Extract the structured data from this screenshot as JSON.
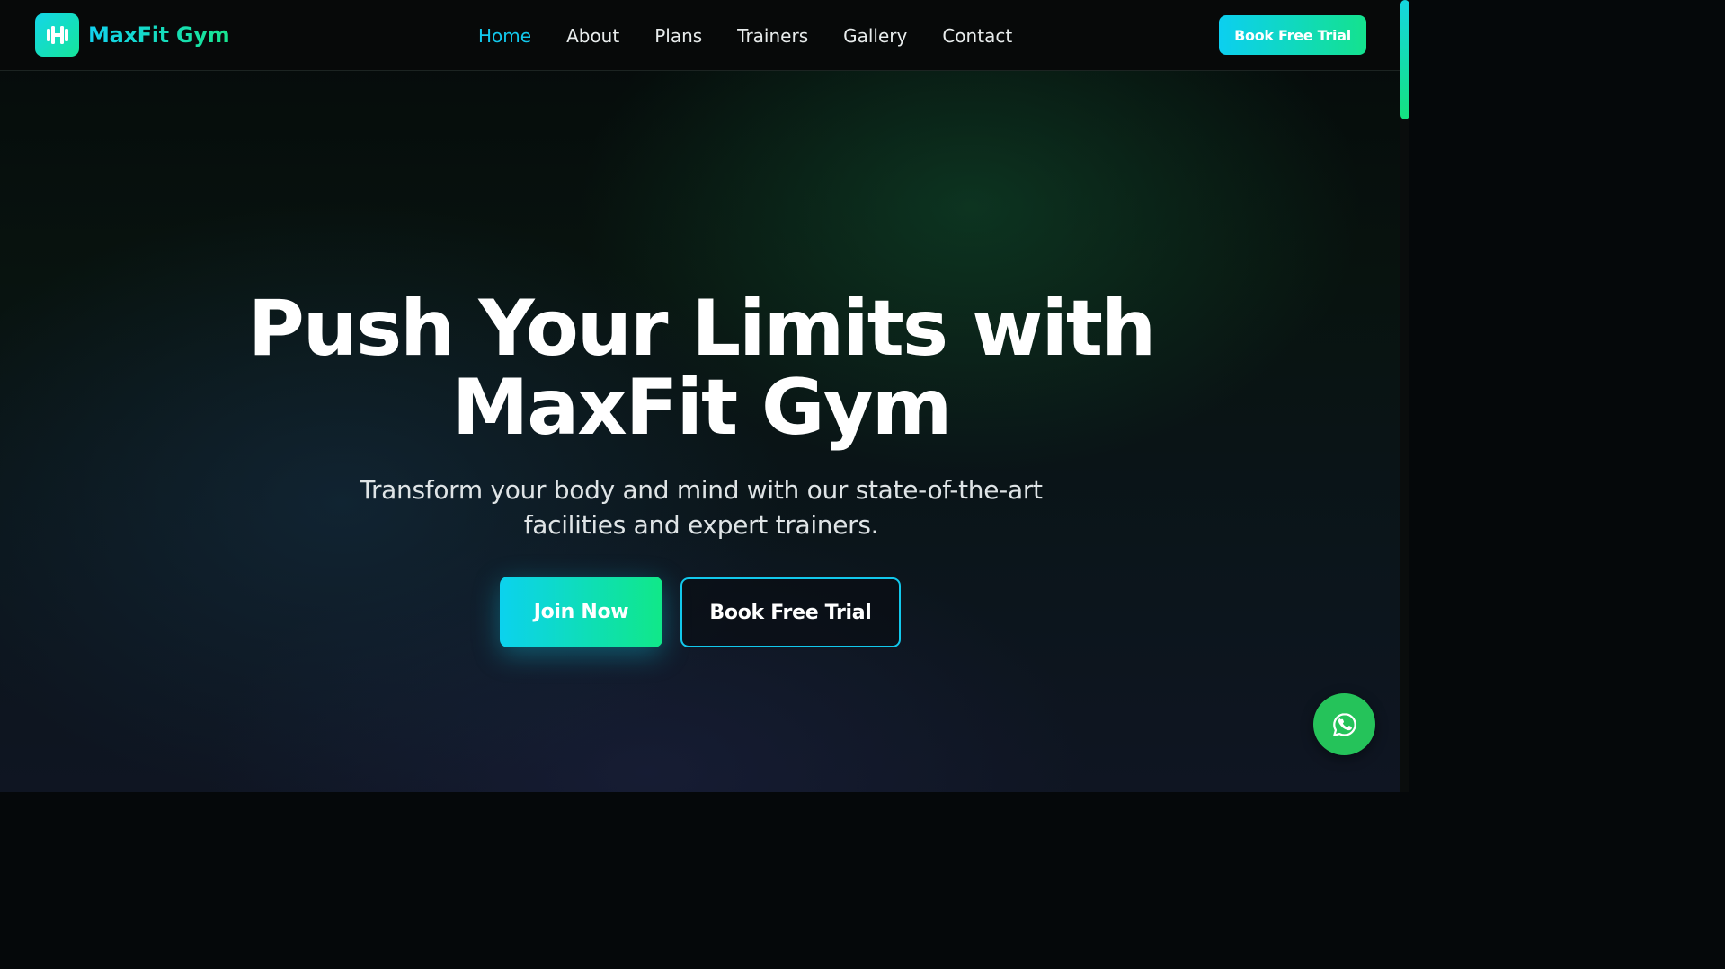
{
  "brand": {
    "name": "MaxFit Gym",
    "icon": "dumbbell-icon",
    "gradient": [
      "#14d6e8",
      "#15e59a"
    ]
  },
  "nav": {
    "items": [
      {
        "label": "Home",
        "active": true
      },
      {
        "label": "About",
        "active": false
      },
      {
        "label": "Plans",
        "active": false
      },
      {
        "label": "Trainers",
        "active": false
      },
      {
        "label": "Gallery",
        "active": false
      },
      {
        "label": "Contact",
        "active": false
      }
    ],
    "cta_label": "Book Free Trial",
    "active_color": "#12c8ec"
  },
  "hero": {
    "title_line1": "Push Your Limits with",
    "title_line2": "MaxFit Gym",
    "subtitle": "Transform your body and mind with our state-of-the-art facilities and expert trainers.",
    "primary_button": "Join Now",
    "secondary_button": "Book Free Trial"
  },
  "floating": {
    "whatsapp_icon": "whatsapp-icon",
    "whatsapp_color": "#25c35a"
  }
}
